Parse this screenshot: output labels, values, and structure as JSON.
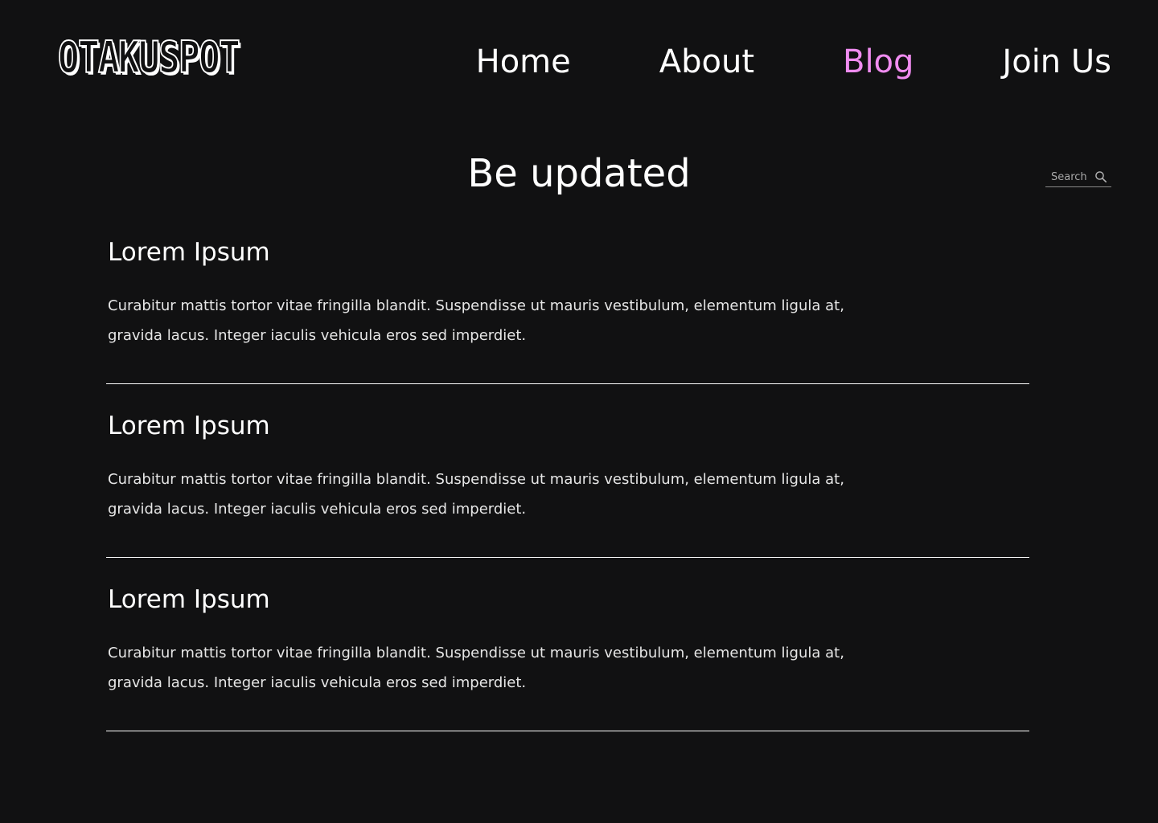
{
  "brand": {
    "logo_text": "OTAKUSPOT"
  },
  "nav": {
    "items": [
      {
        "label": "Home",
        "active": false
      },
      {
        "label": "About",
        "active": false
      },
      {
        "label": "Blog",
        "active": true
      },
      {
        "label": "Join Us",
        "active": false
      }
    ],
    "active_color": "#f08cf0"
  },
  "page": {
    "title": "Be updated"
  },
  "search": {
    "placeholder": "Search",
    "icon": "magnifier-icon"
  },
  "posts": [
    {
      "title": "Lorem Ipsum",
      "excerpt": "Curabitur mattis tortor vitae fringilla blandit. Suspendisse ut mauris vestibulum, elementum ligula at, gravida lacus. Integer iaculis vehicula eros sed imperdiet."
    },
    {
      "title": "Lorem Ipsum",
      "excerpt": "Curabitur mattis tortor vitae fringilla blandit. Suspendisse ut mauris vestibulum, elementum ligula at, gravida lacus. Integer iaculis vehicula eros sed imperdiet."
    },
    {
      "title": "Lorem Ipsum",
      "excerpt": "Curabitur mattis tortor vitae fringilla blandit. Suspendisse ut mauris vestibulum, elementum ligula at, gravida lacus. Integer iaculis vehicula eros sed imperdiet."
    }
  ],
  "colors": {
    "background": "#111112",
    "text": "#ffffff",
    "accent": "#f08cf0"
  }
}
